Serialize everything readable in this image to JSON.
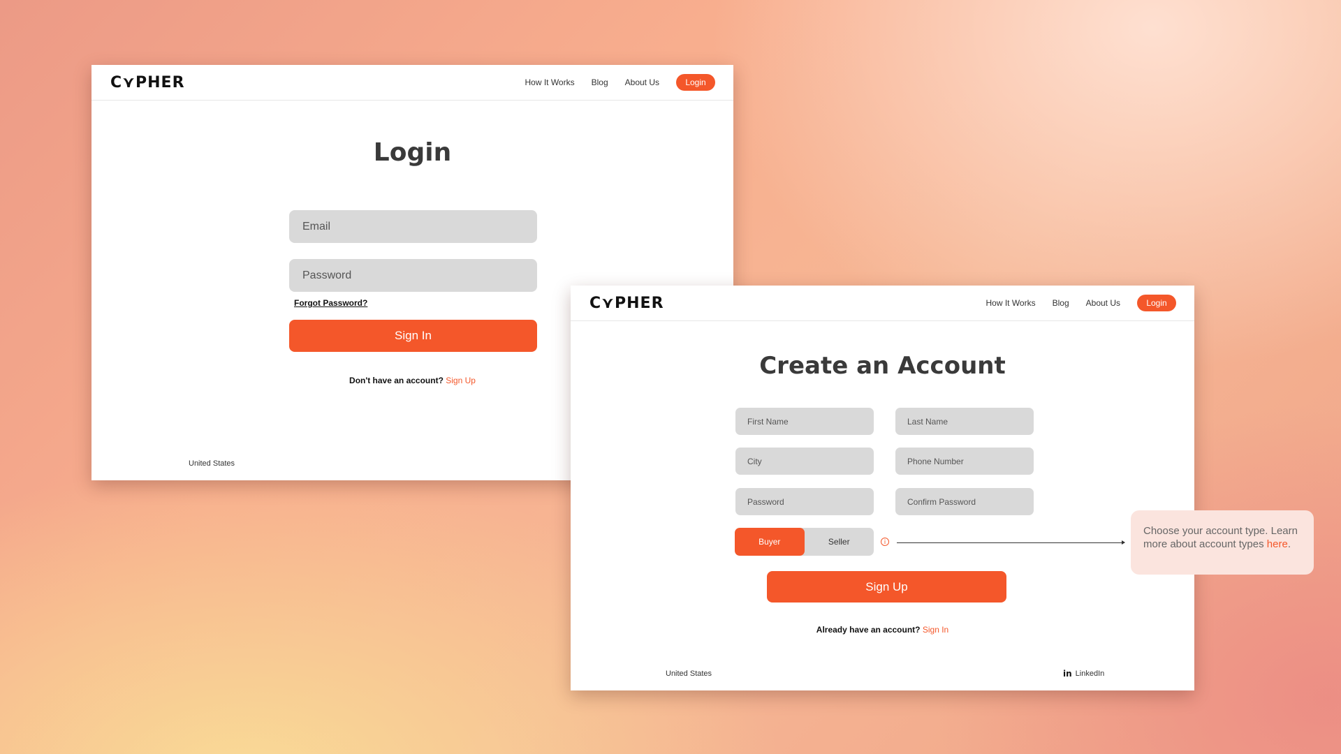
{
  "brand": {
    "logo_text": "C⋎PHER"
  },
  "nav": {
    "how_it_works": "How It Works",
    "blog": "Blog",
    "about_us": "About Us",
    "login": "Login"
  },
  "login_page": {
    "title": "Login",
    "email_placeholder": "Email",
    "password_placeholder": "Password",
    "forgot_password": "Forgot Password?",
    "sign_in_button": "Sign In",
    "no_account_text": "Don't have an account?",
    "sign_up_link": "Sign Up",
    "footer_country": "United States"
  },
  "signup_page": {
    "title": "Create an Account",
    "first_name_placeholder": "First Name",
    "last_name_placeholder": "Last Name",
    "city_placeholder": "City",
    "phone_placeholder": "Phone Number",
    "password_placeholder": "Password",
    "confirm_password_placeholder": "Confirm Password",
    "account_types": [
      "Buyer",
      "Seller"
    ],
    "selected_account_type": "Buyer",
    "info_icon_glyph": "i",
    "sign_up_button": "Sign Up",
    "have_account_text": "Already have an account?",
    "sign_in_link": "Sign In",
    "footer_country": "United States",
    "linkedin_icon_text": "in",
    "linkedin_label": "LinkedIn"
  },
  "tooltip": {
    "text": "Choose your account type. Learn more about account types",
    "link": "here",
    "end": "."
  },
  "colors": {
    "accent": "#f4572a",
    "field_bg": "#d9d9d9",
    "tooltip_bg": "#fbe4de"
  }
}
